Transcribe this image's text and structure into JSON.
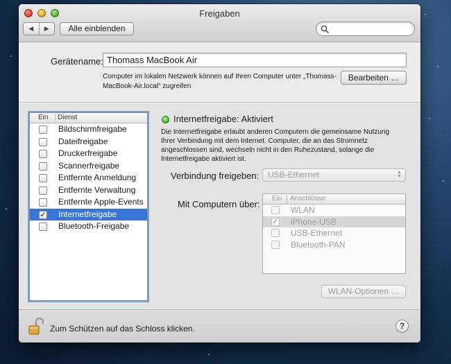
{
  "window": {
    "title": "Freigaben"
  },
  "toolbar": {
    "back_icon": "◀",
    "forward_icon": "▶",
    "show_all_label": "Alle einblenden",
    "search_placeholder": ""
  },
  "computer_name": {
    "label": "Gerätename:",
    "value": "Thomass MacBook Air",
    "description": "Computer im lokalen Netzwerk können auf Ihren Computer unter „Thomass-MacBook-Air.local“ zugreifen",
    "edit_label": "Bearbeiten …"
  },
  "services": {
    "header_on": "Ein",
    "header_service": "Dienst",
    "items": [
      {
        "label": "Bildschirmfreigabe",
        "checked": false,
        "selected": false
      },
      {
        "label": "Dateifreigabe",
        "checked": false,
        "selected": false
      },
      {
        "label": "Druckerfreigabe",
        "checked": false,
        "selected": false
      },
      {
        "label": "Scannerfreigabe",
        "checked": false,
        "selected": false
      },
      {
        "label": "Entfernte Anmeldung",
        "checked": false,
        "selected": false
      },
      {
        "label": "Entfernte Verwaltung",
        "checked": false,
        "selected": false
      },
      {
        "label": "Entfernte Apple-Events",
        "checked": false,
        "selected": false
      },
      {
        "label": "Internetfreigabe",
        "checked": true,
        "selected": true
      },
      {
        "label": "Bluetooth-Freigabe",
        "checked": false,
        "selected": false
      }
    ]
  },
  "detail": {
    "status_title": "Internetfreigabe: Aktiviert",
    "status_color": "#4dbb2a",
    "description": "Die Internetfreigabe erlaubt anderen Computern die gemeinsame Nutzung Ihrer Verbindung mit dem Internet. Computer, die an das Stromnetz angeschlossen sind, wechseln nicht in den Ruhezustand, solange die Internetfreigabe aktiviert ist.",
    "share_from_label": "Verbindung freigeben:",
    "share_from_value": "USB-Ethernet",
    "to_computers_label": "Mit Computern über:",
    "ports_header_on": "Ein",
    "ports_header_name": "Anschlüsse",
    "ports": [
      {
        "label": "WLAN",
        "checked": false,
        "highlight": false
      },
      {
        "label": "iPhone-USB",
        "checked": true,
        "highlight": true
      },
      {
        "label": "USB-Ethernet",
        "checked": false,
        "highlight": false
      },
      {
        "label": "Bluetooth-PAN",
        "checked": false,
        "highlight": false
      }
    ],
    "wlan_options_label": "WLAN-Optionen …"
  },
  "footer": {
    "lock_icon": "open-lock-icon",
    "lock_text": "Zum Schützen auf das Schloss klicken.",
    "help_label": "?"
  }
}
